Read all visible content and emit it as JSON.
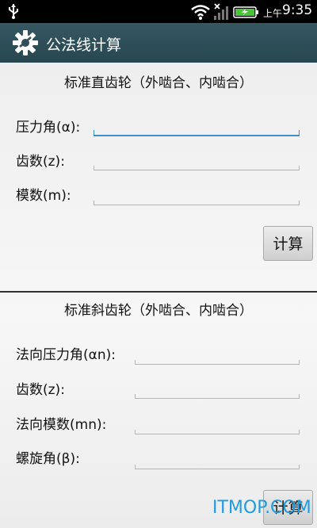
{
  "status": {
    "ampm": "上午",
    "time": "9:35"
  },
  "app": {
    "title": "公法线计算"
  },
  "spur": {
    "heading": "标准直齿轮（外啮合、内啮合）",
    "pressure_angle_label": "压力角(α):",
    "teeth_label": "齿数(z):",
    "module_label": "模数(m):",
    "calc_label": "计算"
  },
  "helical": {
    "heading": "标准斜齿轮（外啮合、内啮合）",
    "normal_pressure_angle_label": "法向压力角(αn):",
    "teeth_label": "齿数(z):",
    "normal_module_label": "法向模数(mn):",
    "helix_angle_label": "螺旋角(β):",
    "calc_label": "计算"
  },
  "watermark": "ITMOP.COM",
  "colors": {
    "titlebar": "#2f5059",
    "focus": "#3f8fc5",
    "watermark": "#1f9be0"
  }
}
